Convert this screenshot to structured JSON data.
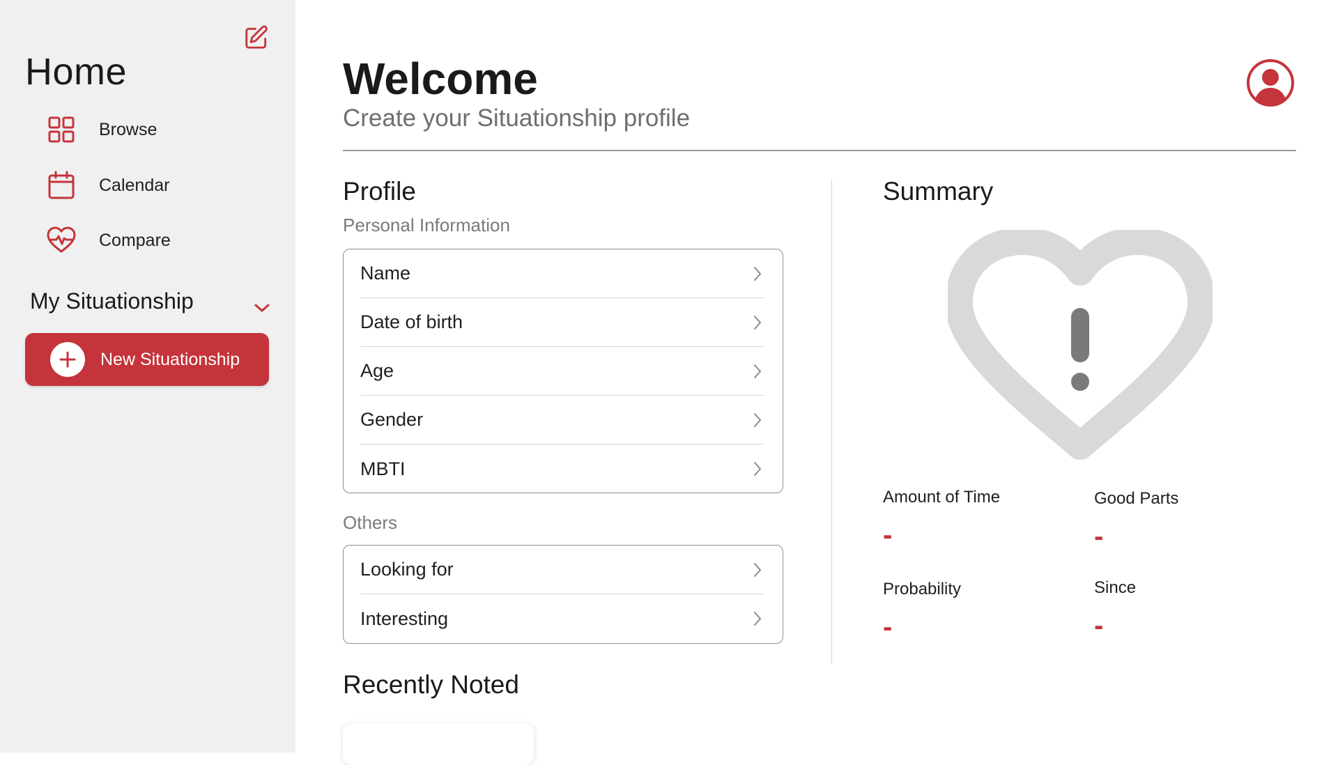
{
  "sidebar": {
    "title": "Home",
    "nav": [
      {
        "label": "Browse",
        "icon": "grid-icon"
      },
      {
        "label": "Calendar",
        "icon": "calendar-icon"
      },
      {
        "label": "Compare",
        "icon": "heart-pulse-icon"
      }
    ],
    "section_title": "My Situationship",
    "new_button_label": "New Situationship"
  },
  "header": {
    "title": "Welcome",
    "subtitle": "Create your Situationship profile"
  },
  "profile": {
    "title": "Profile",
    "personal_label": "Personal Information",
    "personal_rows": [
      "Name",
      "Date of birth",
      "Age",
      "Gender",
      "MBTI"
    ],
    "others_label": "Others",
    "others_rows": [
      "Looking for",
      "Interesting"
    ]
  },
  "recent": {
    "title": "Recently Noted"
  },
  "summary": {
    "title": "Summary",
    "stats": {
      "amount_of_time": {
        "label": "Amount of Time",
        "value": "-"
      },
      "good_parts": {
        "label": "Good Parts",
        "value": "-"
      },
      "probability": {
        "label": "Probability",
        "value": "-"
      },
      "since": {
        "label": "Since",
        "value": "-"
      }
    }
  },
  "colors": {
    "accent": "#c4343a",
    "sidebar_bg": "#f0f0f0",
    "heart_placeholder": "#d9d9d9",
    "exclamation": "#7a7a7a"
  }
}
